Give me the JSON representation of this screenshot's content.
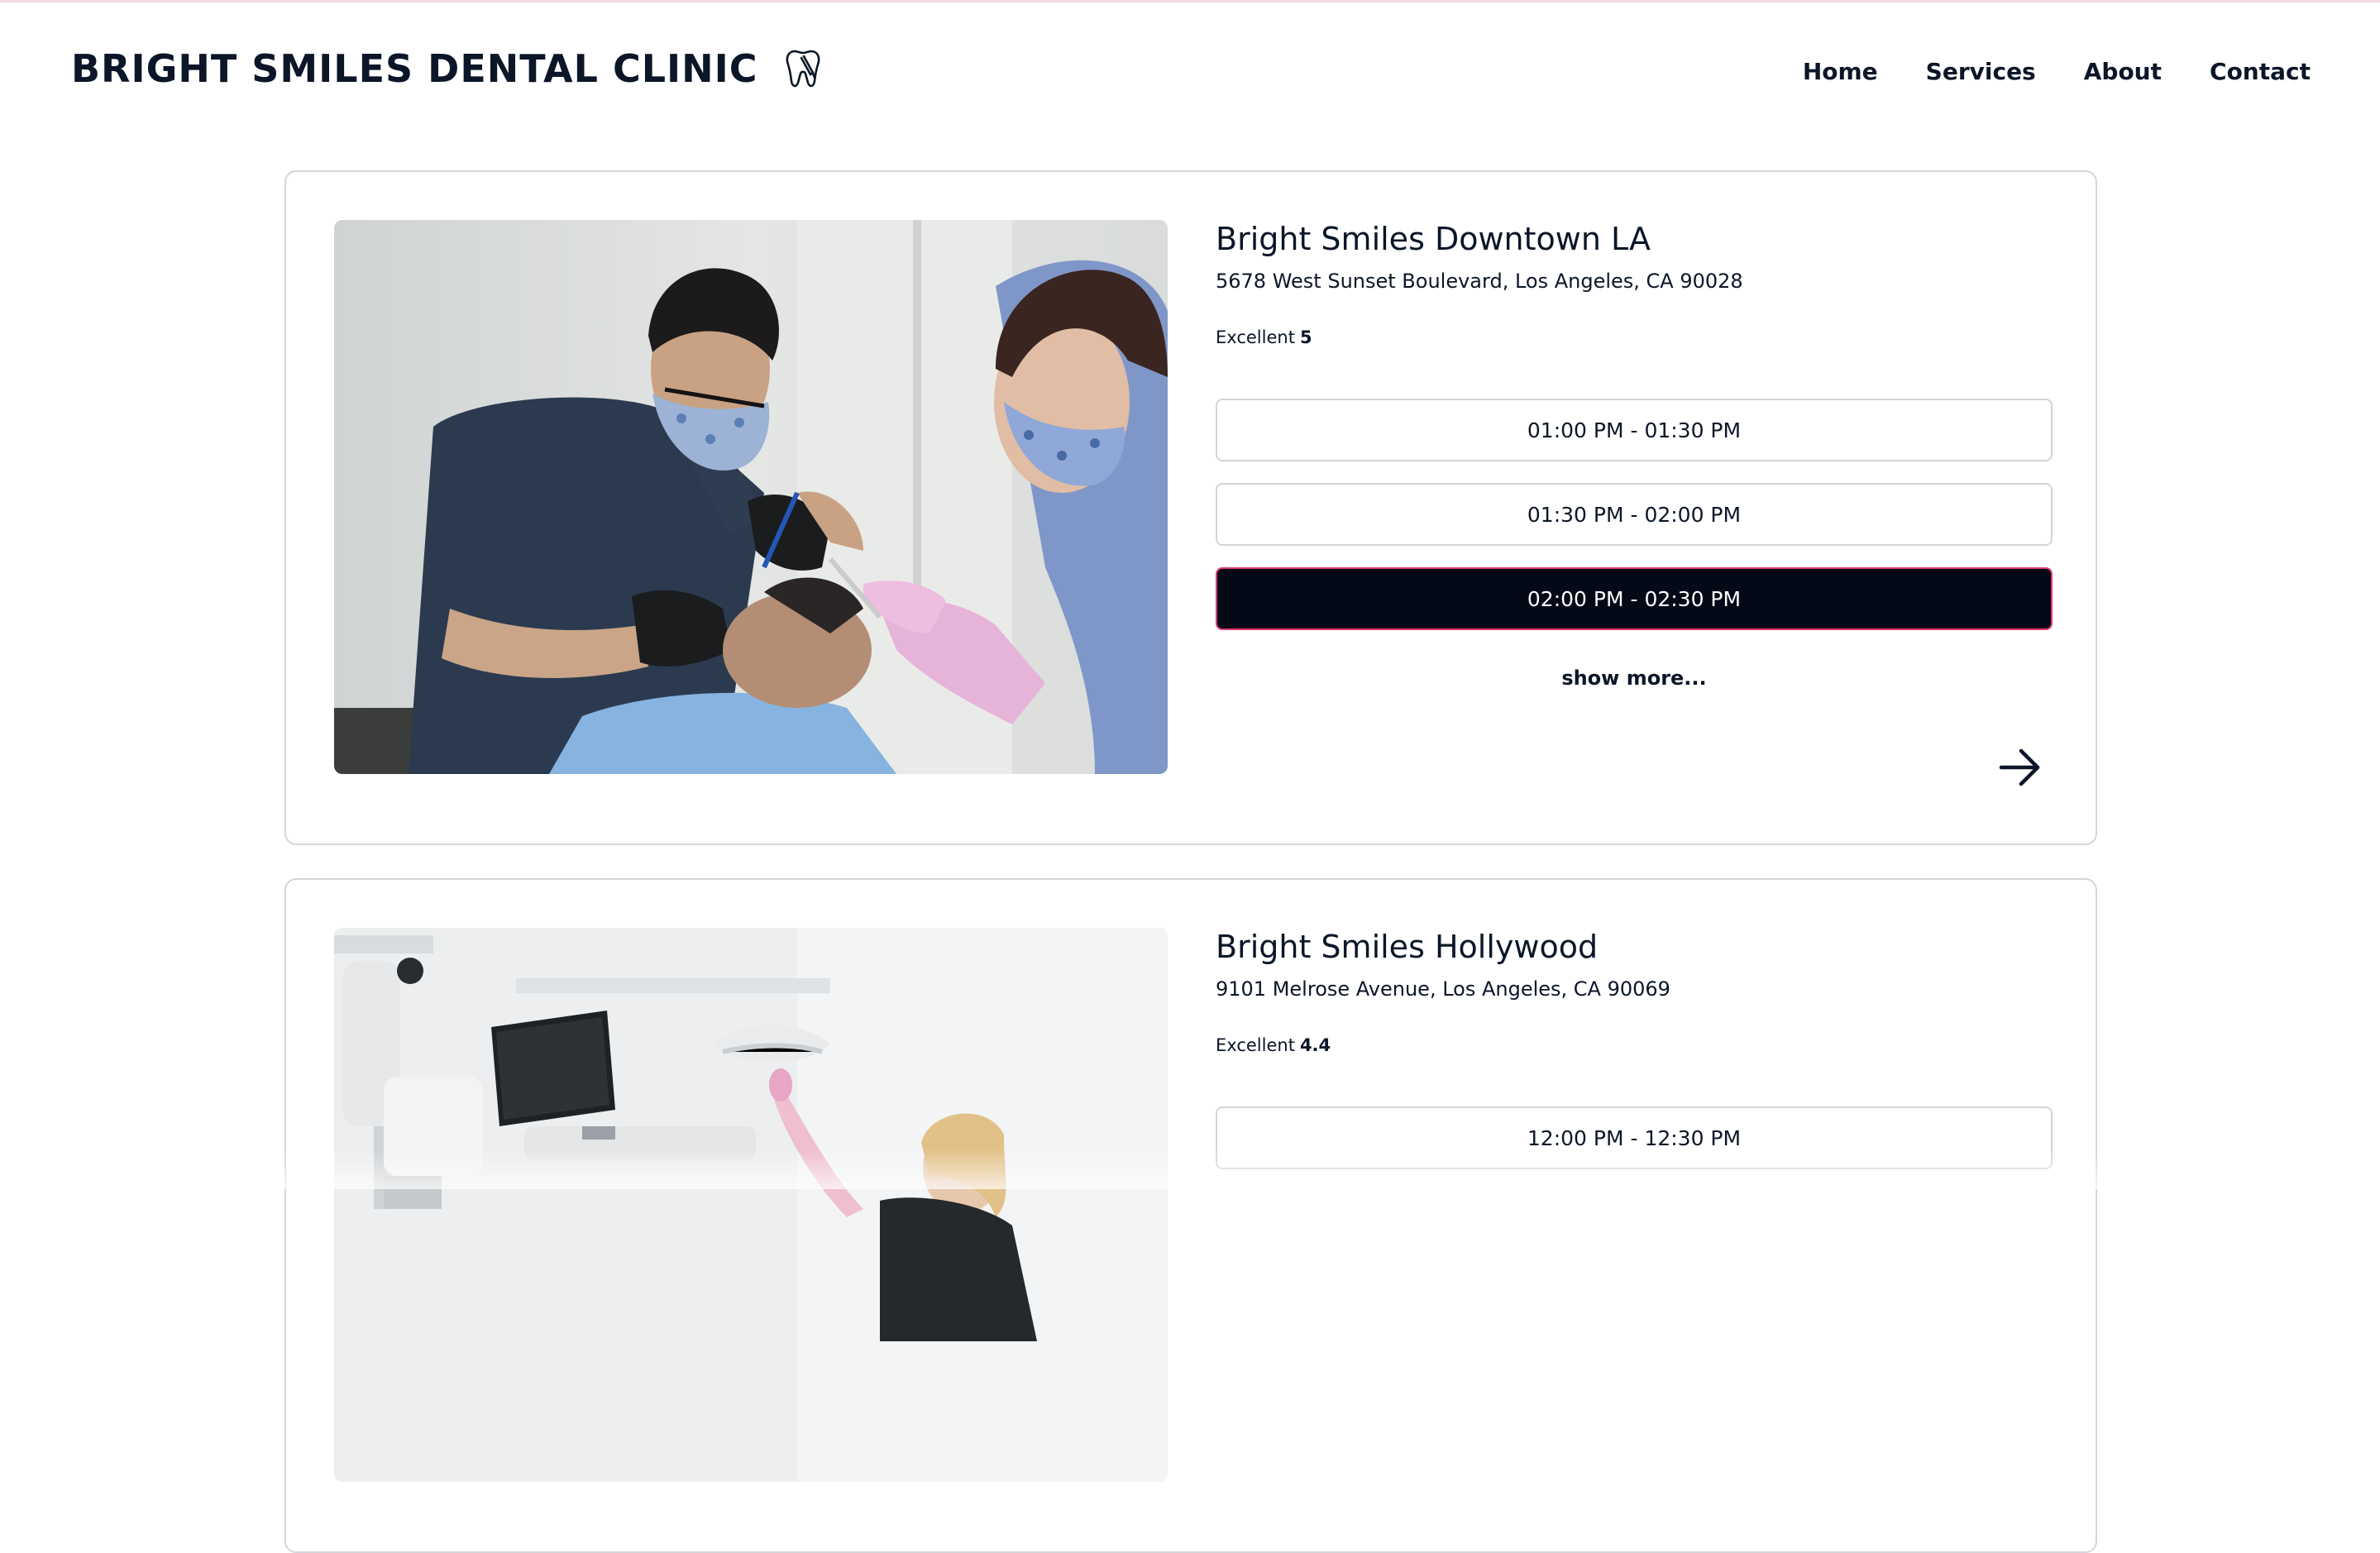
{
  "header": {
    "brand": "BRIGHT SMILES DENTAL CLINIC",
    "brand_icon": "tooth-icon",
    "nav": [
      {
        "label": "Home"
      },
      {
        "label": "Services"
      },
      {
        "label": "About"
      },
      {
        "label": "Contact"
      }
    ]
  },
  "clinics": [
    {
      "name": "Bright Smiles Downtown LA",
      "address": "5678 West Sunset Boulevard, Los Angeles, CA 90028",
      "rating_label": "Excellent",
      "rating_value": "5",
      "photo": "dentist-treating-patient-photo",
      "slots": [
        {
          "label": "01:00 PM - 01:30 PM",
          "selected": false
        },
        {
          "label": "01:30 PM - 02:00 PM",
          "selected": false
        },
        {
          "label": "02:00 PM - 02:30 PM",
          "selected": true
        }
      ],
      "show_more": "show more...",
      "arrow_icon": "arrow-right-icon"
    },
    {
      "name": "Bright Smiles Hollywood",
      "address": "9101 Melrose Avenue, Los Angeles, CA 90069",
      "rating_label": "Excellent",
      "rating_value": "4.4",
      "photo": "dental-office-photo",
      "slots": [
        {
          "label": "12:00 PM - 12:30 PM",
          "selected": false
        }
      ]
    }
  ],
  "colors": {
    "text": "#0b1628",
    "selected_slot_bg": "#040918",
    "selected_slot_border": "#e23a74",
    "border": "#d3d6db"
  }
}
